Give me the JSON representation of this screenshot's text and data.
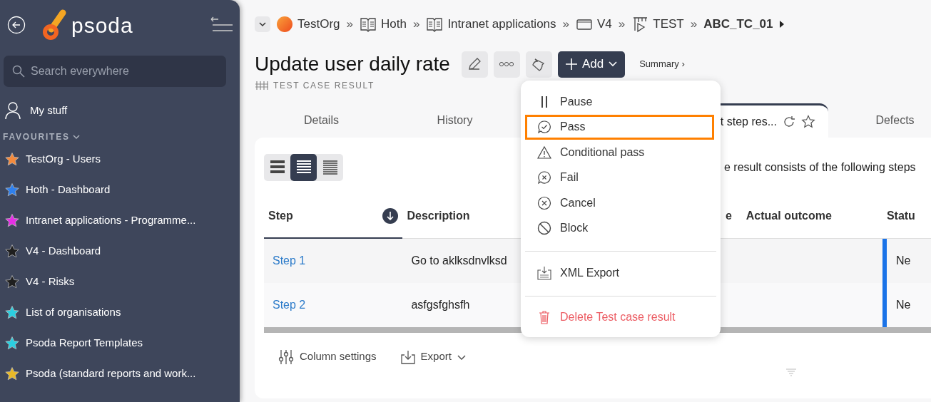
{
  "sidebar": {
    "logo": "psoda",
    "search": {
      "placeholder": "Search everywhere"
    },
    "my_stuff": "My stuff",
    "favourites_heading": "FAVOURITES",
    "favourites": [
      {
        "label": "TestOrg - Users",
        "color": "#f58a3c"
      },
      {
        "label": "Hoth - Dashboard",
        "color": "#2f80ed"
      },
      {
        "label": "Intranet applications - Programme...",
        "color": "#e62ee6"
      },
      {
        "label": "V4 - Dashboard",
        "color": "#1f1f1f"
      },
      {
        "label": "V4 - Risks",
        "color": "#1f1f1f"
      },
      {
        "label": "List of organisations",
        "color": "#2ccfe0"
      },
      {
        "label": "Psoda Report Templates",
        "color": "#2ccfe0"
      },
      {
        "label": "Psoda (standard reports and work...",
        "color": "#e8b928"
      }
    ]
  },
  "breadcrumbs": [
    {
      "label": "TestOrg",
      "kind": "org"
    },
    {
      "label": "Hoth",
      "kind": "book",
      "separator": "»"
    },
    {
      "label": "Intranet applications",
      "kind": "book",
      "separator": "»"
    },
    {
      "label": "V4",
      "kind": "board",
      "separator": "»"
    },
    {
      "label": "TEST",
      "kind": "test",
      "separator": "»"
    },
    {
      "label": "ABC_TC_01",
      "kind": "current",
      "separator": "»"
    }
  ],
  "title": "Update user daily rate",
  "subtitle": "TEST CASE RESULT",
  "add_button": "Add",
  "summary_link": "Summary ›",
  "tabs": [
    {
      "label": "Details",
      "selected": false
    },
    {
      "label": "History",
      "selected": false
    },
    {
      "label": "t step res...",
      "selected": true
    },
    {
      "label": "Defects",
      "selected": false
    }
  ],
  "view_modes": [
    {
      "selected": false
    },
    {
      "selected": true
    },
    {
      "selected": false
    }
  ],
  "intro": "e result consists of the following steps",
  "table": {
    "columns": [
      {
        "label": "Step",
        "sorted": true
      },
      {
        "label": "Description",
        "sorted": false
      },
      {
        "label": "e",
        "sorted": false
      },
      {
        "label": "Actual outcome",
        "sorted": false
      },
      {
        "label": "Statu",
        "sorted": false
      }
    ],
    "rows": [
      {
        "step": "Step 1",
        "description": "Go to aklksdnvlksd",
        "status": "Ne",
        "color": "#1a73e8"
      },
      {
        "step": "Step 2",
        "description": "asfgsfghsfh",
        "status": "Ne",
        "color": "#1a73e8"
      }
    ]
  },
  "footer": {
    "column_settings": "Column settings",
    "export": "Export"
  },
  "menu": {
    "sections": [
      {
        "items": [
          {
            "label": "Pause",
            "kind": "pause",
            "highlighted": false
          },
          {
            "label": "Pass",
            "kind": "pass",
            "highlighted": true
          },
          {
            "label": "Conditional pass",
            "kind": "warning",
            "highlighted": false
          },
          {
            "label": "Fail",
            "kind": "fail",
            "highlighted": false
          },
          {
            "label": "Cancel",
            "kind": "cancel",
            "highlighted": false
          },
          {
            "label": "Block",
            "kind": "block",
            "highlighted": false
          }
        ]
      },
      {
        "items": [
          {
            "label": "XML Export",
            "kind": "xml",
            "highlighted": false
          }
        ]
      },
      {
        "items": [
          {
            "label": "Delete Test case result",
            "kind": "delete",
            "highlighted": false
          }
        ]
      }
    ]
  }
}
